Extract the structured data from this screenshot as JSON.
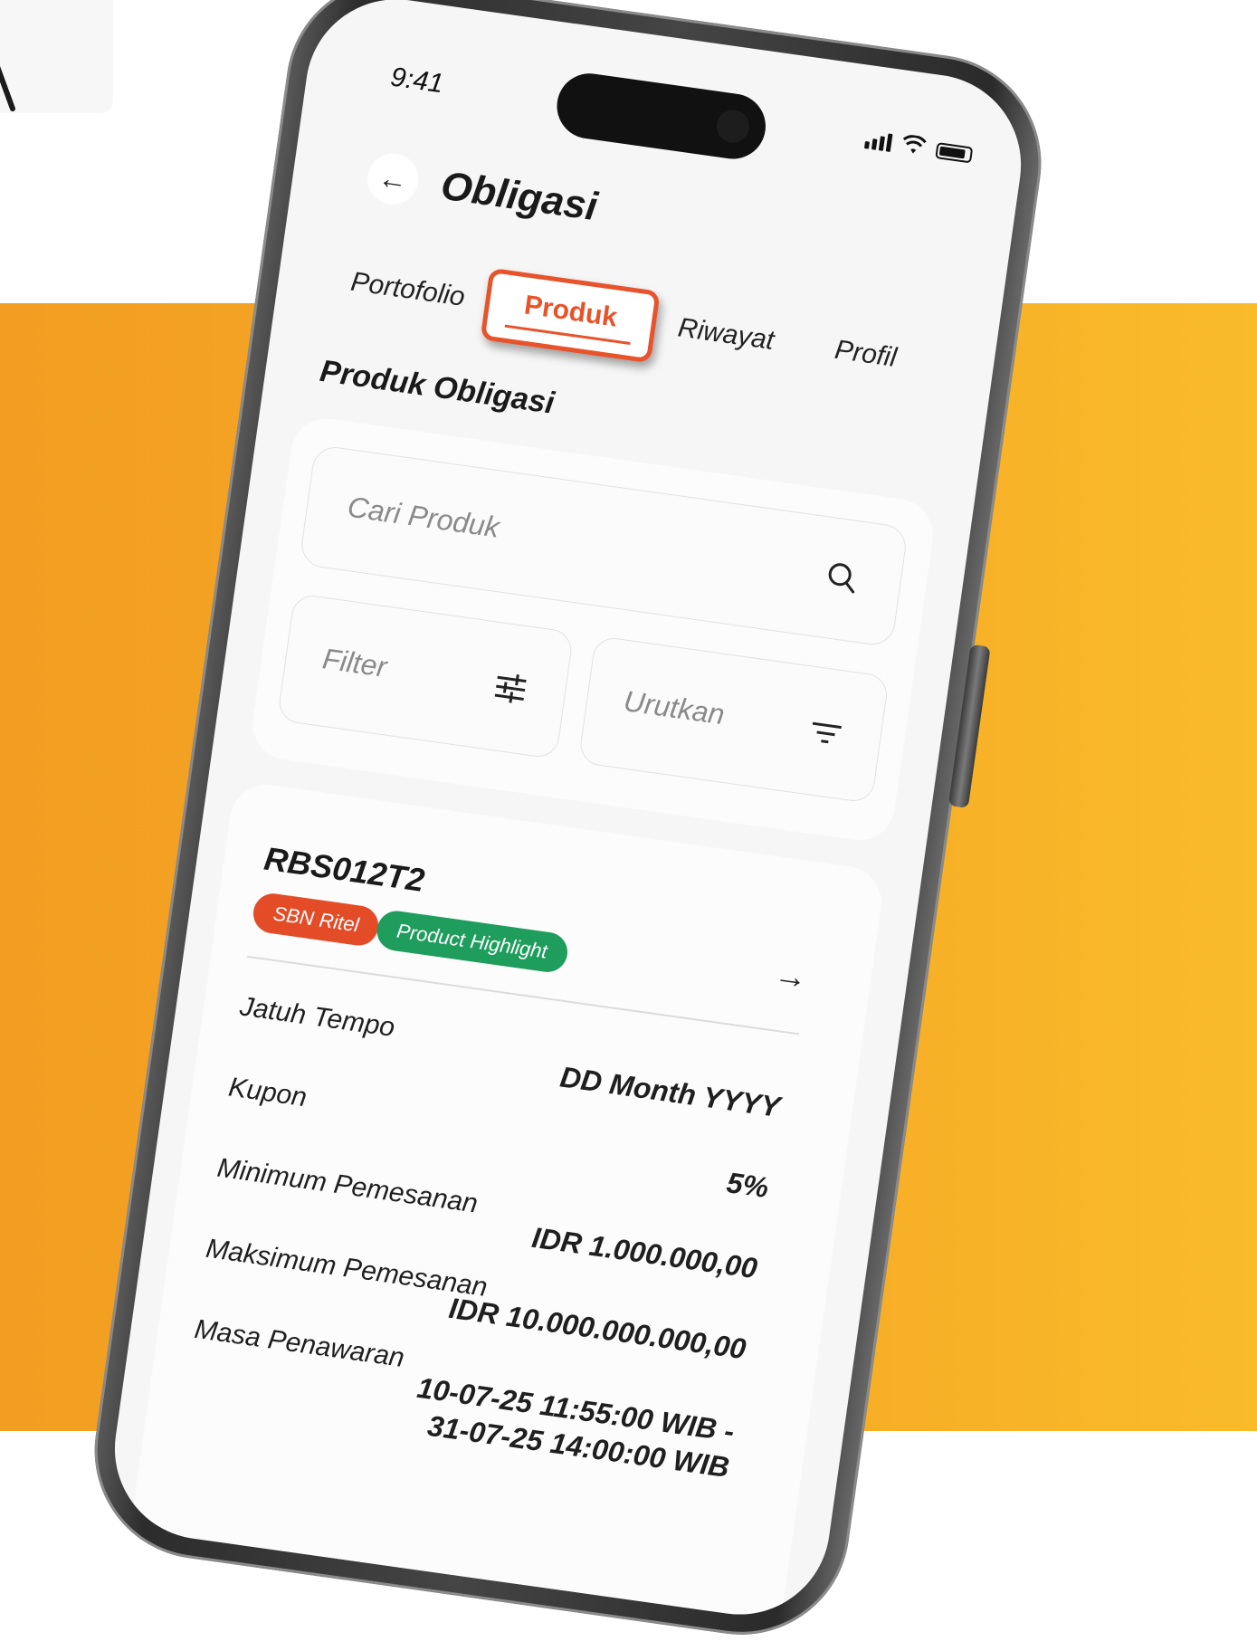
{
  "status": {
    "time": "9:41"
  },
  "header": {
    "title": "Obligasi"
  },
  "tabs": [
    {
      "label": "Portofolio"
    },
    {
      "label": "Produk"
    },
    {
      "label": "Riwayat"
    },
    {
      "label": "Profil"
    }
  ],
  "section_title": "Produk Obligasi",
  "search": {
    "placeholder": "Cari Produk"
  },
  "controls": {
    "filter_label": "Filter",
    "sort_label": "Urutkan"
  },
  "product": {
    "code": "RBS012T2",
    "badges": [
      "SBN Ritel",
      "Product Highlight"
    ],
    "details": [
      {
        "label": "Jatuh Tempo",
        "value": "DD Month YYYY"
      },
      {
        "label": "Kupon",
        "value": "5%"
      },
      {
        "label": "Minimum Pemesanan",
        "value": "IDR 1.000.000,00"
      },
      {
        "label": "Maksimum Pemesanan",
        "value": "IDR 10.000.000.000,00"
      },
      {
        "label": "Masa Penawaran",
        "value_line1": "10-07-25 11:55:00 WIB -",
        "value_line2": "31-07-25 14:00:00 WIB"
      }
    ]
  },
  "colors": {
    "accent": "#e8532b",
    "badge_red": "#e44b27",
    "badge_green": "#1f9d5c",
    "background_orange": "#f6a925"
  }
}
